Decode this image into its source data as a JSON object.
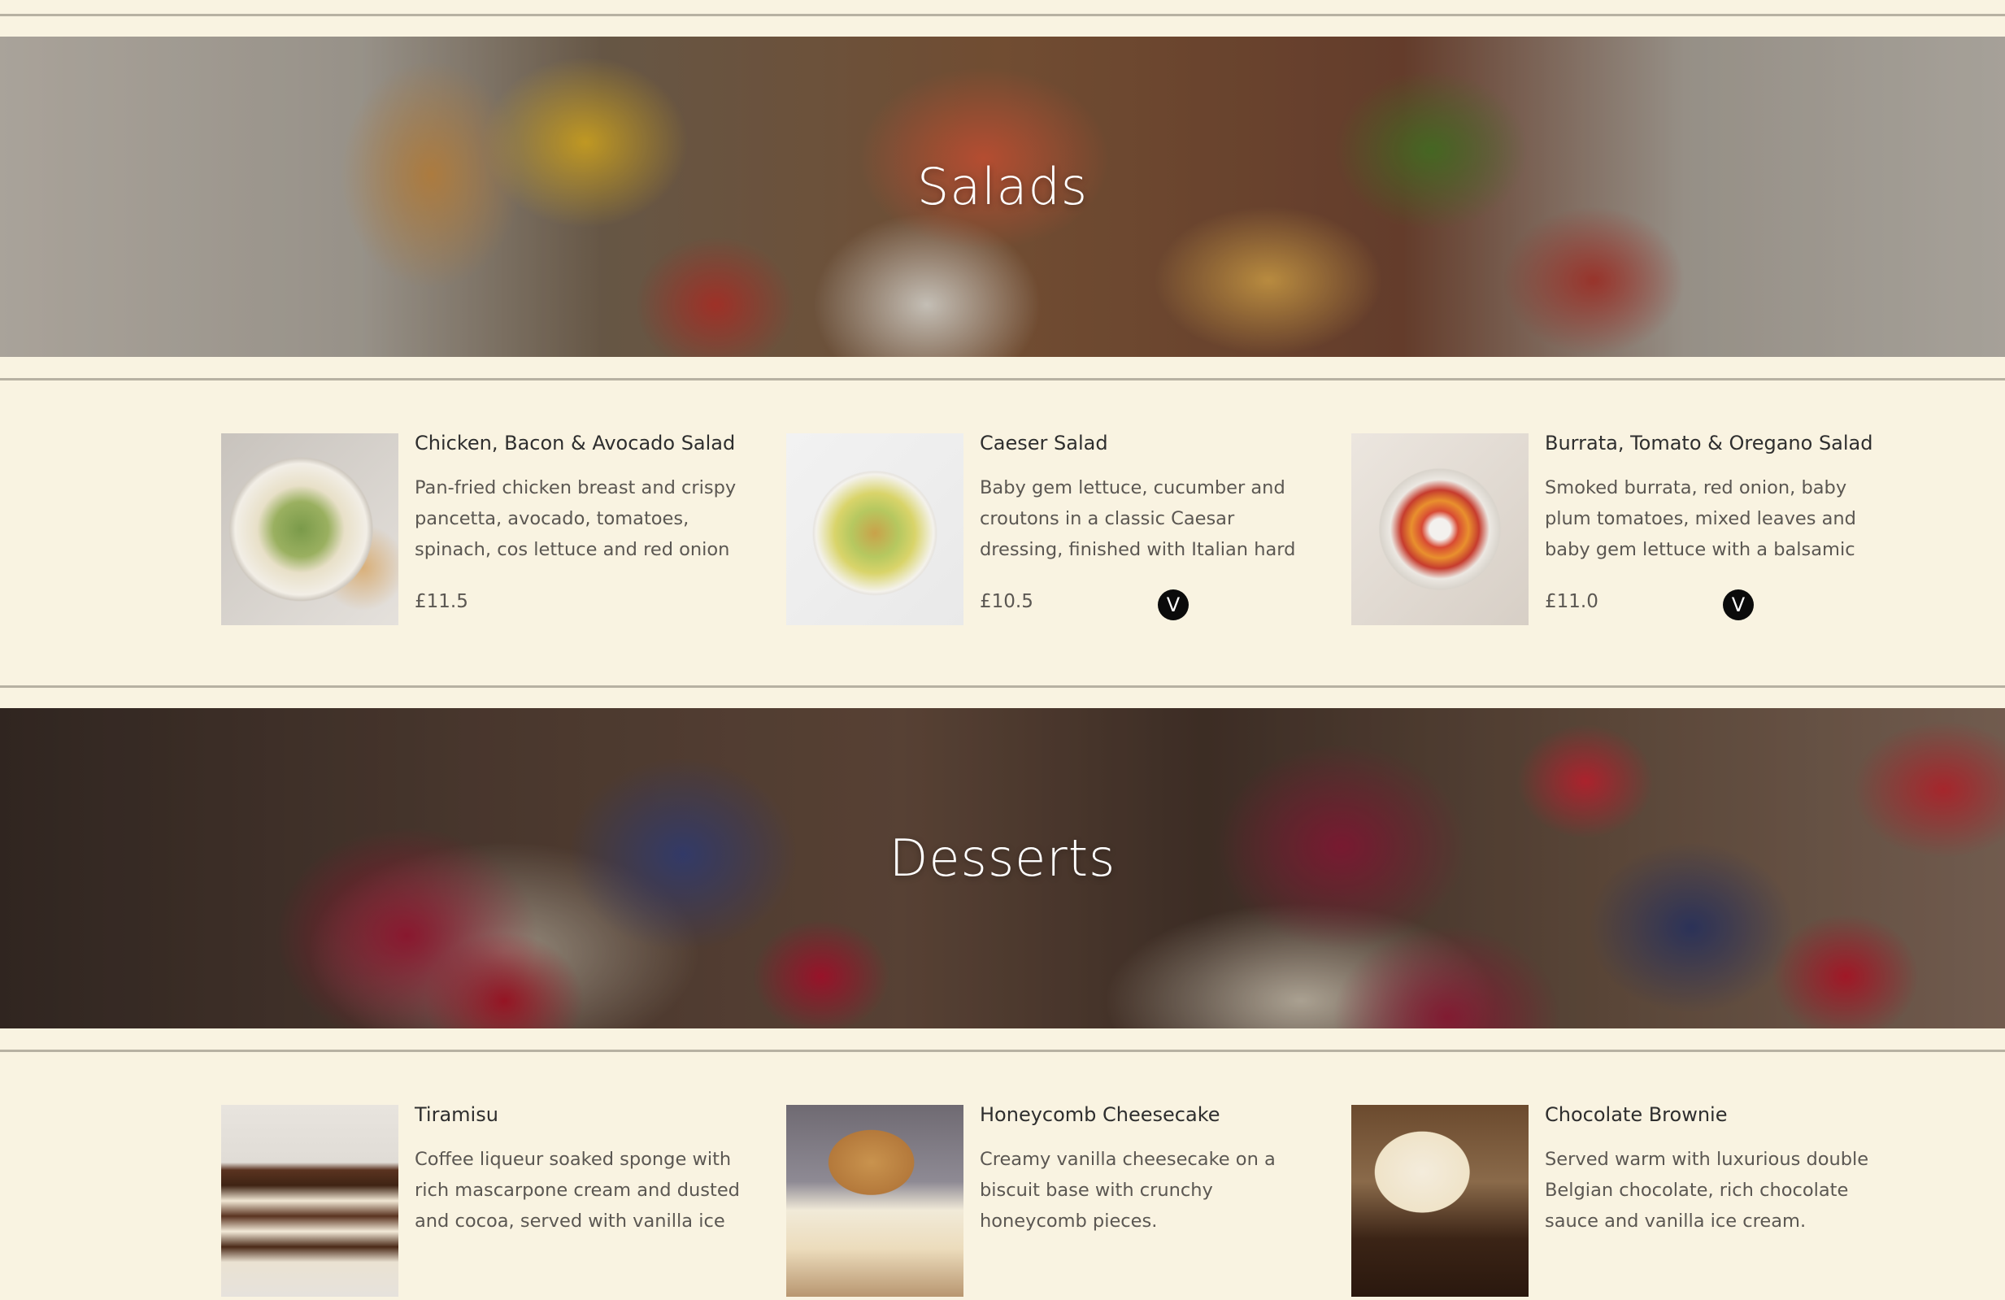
{
  "sections": [
    {
      "title": "Salads",
      "items": [
        {
          "name": "Chicken, Bacon & Avocado Salad",
          "description": "Pan-fried chicken breast and crispy pancetta, avocado, tomatoes, spinach, cos lettuce and red onion",
          "price": "£11.5",
          "badge": ""
        },
        {
          "name": "Caeser Salad",
          "description": "Baby gem lettuce, cucumber and croutons in a classic Caesar dressing, finished with Italian hard cheese.",
          "price": "£10.5",
          "badge": "V"
        },
        {
          "name": "Burrata, Tomato & Oregano Salad",
          "description": "Smoked burrata, red onion, baby plum tomatoes, mixed leaves and baby gem lettuce with a balsamic",
          "price": "£11.0",
          "badge": "V"
        }
      ]
    },
    {
      "title": "Desserts",
      "items": [
        {
          "name": "Tiramisu",
          "description": "Coffee liqueur soaked sponge with rich mascarpone cream and dusted and cocoa, served with vanilla ice",
          "price": "",
          "badge": ""
        },
        {
          "name": "Honeycomb Cheesecake",
          "description": "Creamy vanilla cheesecake on a biscuit base with crunchy honeycomb pieces.",
          "price": "",
          "badge": ""
        },
        {
          "name": "Chocolate Brownie",
          "description": "Served warm with luxurious double Belgian chocolate, rich chocolate sauce and vanilla ice cream.",
          "price": "",
          "badge": ""
        }
      ]
    }
  ]
}
